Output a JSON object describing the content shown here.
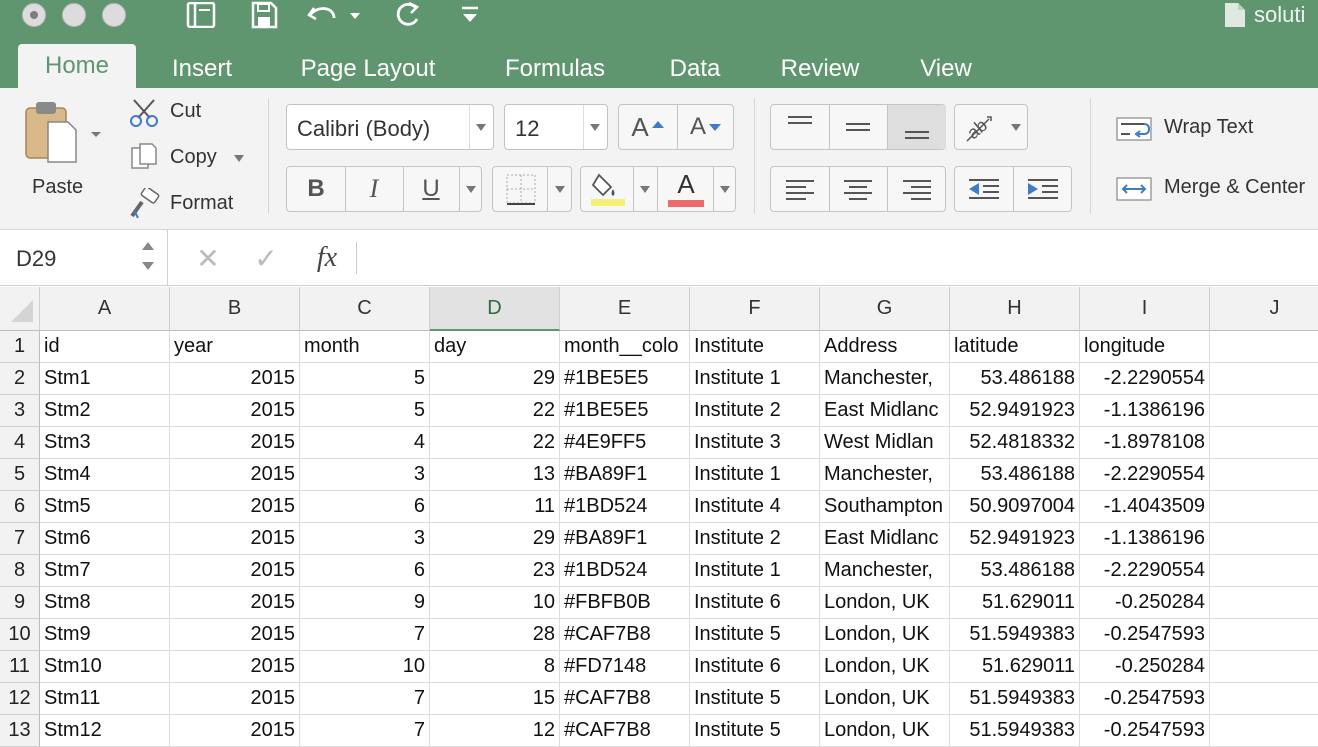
{
  "titlebar": {
    "title": "soluti",
    "quick_access": [
      "sidebar-icon",
      "save-icon",
      "undo-icon",
      "redo-icon",
      "customize-icon"
    ]
  },
  "tabs": [
    "Home",
    "Insert",
    "Page Layout",
    "Formulas",
    "Data",
    "Review",
    "View"
  ],
  "active_tab": "Home",
  "ribbon": {
    "paste": "Paste",
    "cut": "Cut",
    "copy": "Copy",
    "format": "Format",
    "font_name": "Calibri (Body)",
    "font_size": "12",
    "increase_font": "A",
    "decrease_font": "A",
    "bold": "B",
    "italic": "I",
    "underline": "U",
    "font_color": "A",
    "fill_color_hex": "#f5f07a",
    "font_color_hex": "#ef6a6a",
    "wrap_text": "Wrap Text",
    "merge_center": "Merge & Center"
  },
  "formula_bar": {
    "cell_ref": "D29",
    "cancel": "✕",
    "enter": "✓",
    "fx": "fx",
    "value": ""
  },
  "selected_column": "D",
  "columns": [
    "A",
    "B",
    "C",
    "D",
    "E",
    "F",
    "G",
    "H",
    "I",
    "J"
  ],
  "rows": [
    {
      "n": "1",
      "cells": [
        "id",
        "year",
        "month",
        "day",
        "month__colo",
        "Institute",
        "Address",
        "latitude",
        "longitude",
        ""
      ]
    },
    {
      "n": "2",
      "cells": [
        "Stm1",
        "2015",
        "5",
        "29",
        "#1BE5E5",
        "Institute 1",
        "Manchester,",
        "53.486188",
        "-2.2290554",
        ""
      ]
    },
    {
      "n": "3",
      "cells": [
        "Stm2",
        "2015",
        "5",
        "22",
        "#1BE5E5",
        "Institute 2",
        "East Midlanc",
        "52.9491923",
        "-1.1386196",
        ""
      ]
    },
    {
      "n": "4",
      "cells": [
        "Stm3",
        "2015",
        "4",
        "22",
        "#4E9FF5",
        "Institute 3",
        "West Midlan",
        "52.4818332",
        "-1.8978108",
        ""
      ]
    },
    {
      "n": "5",
      "cells": [
        "Stm4",
        "2015",
        "3",
        "13",
        "#BA89F1",
        "Institute 1",
        "Manchester,",
        "53.486188",
        "-2.2290554",
        ""
      ]
    },
    {
      "n": "6",
      "cells": [
        "Stm5",
        "2015",
        "6",
        "11",
        "#1BD524",
        "Institute 4",
        "Southampton",
        "50.9097004",
        "-1.4043509",
        ""
      ]
    },
    {
      "n": "7",
      "cells": [
        "Stm6",
        "2015",
        "3",
        "29",
        "#BA89F1",
        "Institute 2",
        "East Midlanc",
        "52.9491923",
        "-1.1386196",
        ""
      ]
    },
    {
      "n": "8",
      "cells": [
        "Stm7",
        "2015",
        "6",
        "23",
        "#1BD524",
        "Institute 1",
        "Manchester,",
        "53.486188",
        "-2.2290554",
        ""
      ]
    },
    {
      "n": "9",
      "cells": [
        "Stm8",
        "2015",
        "9",
        "10",
        "#FBFB0B",
        "Institute 6",
        "London, UK",
        "51.629011",
        "-0.250284",
        ""
      ]
    },
    {
      "n": "10",
      "cells": [
        "Stm9",
        "2015",
        "7",
        "28",
        "#CAF7B8",
        "Institute 5",
        "London, UK",
        "51.5949383",
        "-0.2547593",
        ""
      ]
    },
    {
      "n": "11",
      "cells": [
        "Stm10",
        "2015",
        "10",
        "8",
        "#FD7148",
        "Institute 6",
        "London, UK",
        "51.629011",
        "-0.250284",
        ""
      ]
    },
    {
      "n": "12",
      "cells": [
        "Stm11",
        "2015",
        "7",
        "15",
        "#CAF7B8",
        "Institute 5",
        "London, UK",
        "51.5949383",
        "-0.2547593",
        ""
      ]
    },
    {
      "n": "13",
      "cells": [
        "Stm12",
        "2015",
        "7",
        "12",
        "#CAF7B8",
        "Institute 5",
        "London, UK",
        "51.5949383",
        "-0.2547593",
        ""
      ]
    }
  ]
}
